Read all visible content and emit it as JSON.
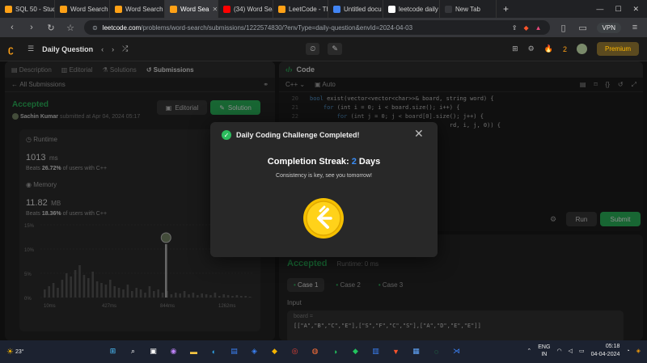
{
  "browser": {
    "tabs": [
      {
        "label": "SQL 50 - Stud",
        "color": "#ffa116"
      },
      {
        "label": "Word Search",
        "color": "#ffa116"
      },
      {
        "label": "Word Search",
        "color": "#ffa116"
      },
      {
        "label": "Word Sea",
        "color": "#ffa116",
        "active": true
      },
      {
        "label": "(34) Word Sea",
        "color": "#ff0000"
      },
      {
        "label": "LeetCode - Th",
        "color": "#ffa116"
      },
      {
        "label": "Untitled docu",
        "color": "#4285f4"
      },
      {
        "label": "leetcode daily",
        "color": "#ffffff"
      },
      {
        "label": "New Tab",
        "color": "#35363a"
      }
    ],
    "new_tab_glyph": "+",
    "url_host": "leetcode.com",
    "url_path": "/problems/word-search/submissions/1222574830/?envType=daily-question&envId=2024-04-03",
    "vpn_label": "VPN"
  },
  "header": {
    "nav_title": "Daily Question",
    "streak_count": "2",
    "premium_label": "Premium"
  },
  "left": {
    "tabs": [
      "Description",
      "Editorial",
      "Solutions",
      "Submissions"
    ],
    "back_label": "All Submissions",
    "status": "Accepted",
    "author": "Sachin Kumar",
    "submitted_text": "submitted at Apr 04, 2024 05:17",
    "editorial_btn": "Editorial",
    "solution_btn": "Solution",
    "runtime_label": "Runtime",
    "runtime_value": "1013",
    "runtime_unit": "ms",
    "runtime_beats_prefix": "Beats",
    "runtime_beats": "26.72%",
    "runtime_beats_suffix": "of users with C++",
    "memory_label": "Memory",
    "memory_value": "11.82",
    "memory_unit": "MB",
    "memory_beats_prefix": "Beats",
    "memory_beats": "18.36%",
    "memory_beats_suffix": "of users with C++",
    "chart_ticks_y": [
      "15%",
      "10%",
      "5%",
      "0%"
    ],
    "chart_ticks_x": [
      "10ms",
      "427ms",
      "844ms",
      "1262ms"
    ]
  },
  "code": {
    "header": "Code",
    "language": "C++",
    "mode": "Auto",
    "lines": [
      {
        "n": "20",
        "kw": "bool",
        "text": " exist(vector<vector<char>>& board, string word) {"
      },
      {
        "n": "21",
        "kw": "    for",
        "text": " (int i = 0; i < board.size(); i++) {"
      },
      {
        "n": "22",
        "kw": "        for",
        "text": " (int j = 0; j < board[0].size(); j++) {"
      },
      {
        "n": "23",
        "kw": "",
        "text": "                                         rd, i, j, 0)) {"
      }
    ],
    "run_label": "Run",
    "submit_label": "Submit"
  },
  "result": {
    "status": "Accepted",
    "runtime": "Runtime: 0 ms",
    "cases": [
      "Case 1",
      "Case 2",
      "Case 3"
    ],
    "input_label": "Input",
    "board_label": "board =",
    "board_value": "[[\"A\",\"B\",\"C\",\"E\"],[\"S\",\"F\",\"C\",\"S\"],[\"A\",\"D\",\"E\",\"E\"]]"
  },
  "modal": {
    "title": "Daily Coding Challenge Completed!",
    "streak_prefix": "Completion Streak:",
    "streak_number": "2",
    "streak_suffix": "Days",
    "subtitle": "Consistency is key, see you tomorrow!"
  },
  "taskbar": {
    "weather": "23°",
    "lang_top": "ENG",
    "lang_bottom": "IN",
    "time": "05:18",
    "date": "04-04-2024"
  }
}
